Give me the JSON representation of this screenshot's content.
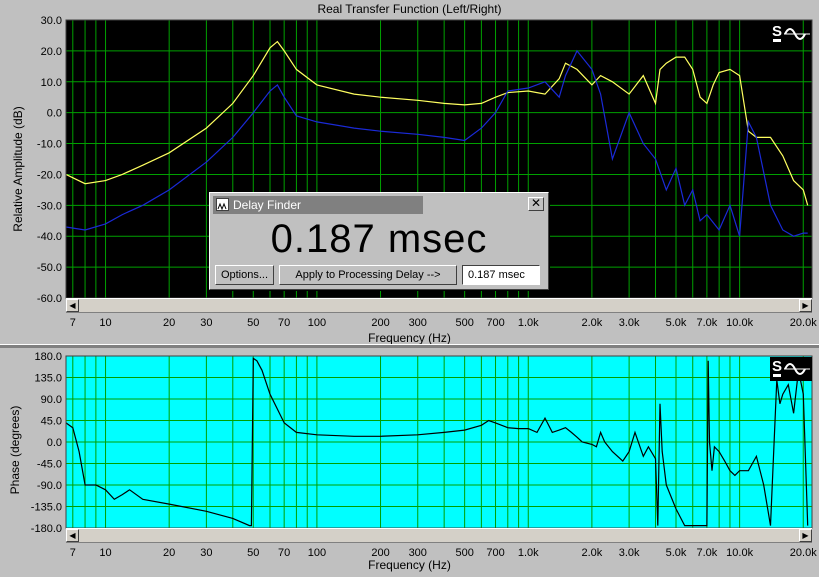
{
  "top_pane": {
    "title": "Real Transfer Function (Left/Right)",
    "ylabel": "Relative Amplitude (dB)",
    "xlabel": "Frequency (Hz)"
  },
  "bottom_pane": {
    "ylabel": "Phase (degrees)",
    "xlabel": "Frequency (Hz)"
  },
  "dialog": {
    "title": "Delay Finder",
    "value": "0.187 msec",
    "options_label": "Options...",
    "apply_label": "Apply to Processing Delay -->",
    "field_value": "0.187 msec",
    "close_glyph": "✕"
  },
  "colors": {
    "top_bg": "#000000",
    "bottom_bg": "#00ffff",
    "grid": "#00a000",
    "bottom_grid": "#00a000",
    "left_trace": "#ffff60",
    "right_trace": "#1a2ad8",
    "phase_trace": "#000000"
  },
  "chart_data": [
    {
      "type": "line",
      "title": "Real Transfer Function (Left/Right)",
      "xlabel": "Frequency (Hz)",
      "ylabel": "Relative Amplitude (dB)",
      "x_scale": "log",
      "xlim": [
        6.5,
        22000
      ],
      "ylim": [
        -60,
        30
      ],
      "yticks": [
        "30.0",
        "20.0",
        "10.0",
        "0.0",
        "-10.0",
        "-20.0",
        "-30.0",
        "-40.0",
        "-50.0",
        "-60.0"
      ],
      "xticks": [
        {
          "v": 7,
          "label": "7"
        },
        {
          "v": 10,
          "label": "10"
        },
        {
          "v": 20,
          "label": "20"
        },
        {
          "v": 30,
          "label": "30"
        },
        {
          "v": 50,
          "label": "50"
        },
        {
          "v": 70,
          "label": "70"
        },
        {
          "v": 100,
          "label": "100"
        },
        {
          "v": 200,
          "label": "200"
        },
        {
          "v": 300,
          "label": "300"
        },
        {
          "v": 500,
          "label": "500"
        },
        {
          "v": 700,
          "label": "700"
        },
        {
          "v": 1000,
          "label": "1.0k"
        },
        {
          "v": 2000,
          "label": "2.0k"
        },
        {
          "v": 3000,
          "label": "3.0k"
        },
        {
          "v": 5000,
          "label": "5.0k"
        },
        {
          "v": 7000,
          "label": "7.0k"
        },
        {
          "v": 10000,
          "label": "10.0k"
        },
        {
          "v": 20000,
          "label": "20.0k"
        }
      ],
      "grid": true,
      "series": [
        {
          "color": "#ffff60",
          "x": [
            6.5,
            8,
            10,
            12,
            15,
            20,
            30,
            40,
            50,
            60,
            65,
            70,
            80,
            100,
            150,
            200,
            300,
            400,
            500,
            600,
            700,
            800,
            1000,
            1200,
            1400,
            1500,
            1700,
            2000,
            2200,
            2500,
            3000,
            3500,
            4000,
            4200,
            4500,
            5000,
            5500,
            6000,
            6500,
            7000,
            7500,
            8000,
            9000,
            10000,
            11000,
            12000,
            14000,
            16000,
            18000,
            20000,
            21000
          ],
          "y": [
            -20,
            -23,
            -22,
            -20,
            -17,
            -13,
            -5,
            3,
            12,
            21,
            23,
            20,
            14,
            9,
            6,
            5,
            4,
            3,
            2.5,
            3,
            5,
            6.5,
            7,
            6,
            11,
            16,
            14,
            9,
            12,
            10,
            6,
            12,
            3,
            14,
            16,
            18,
            18,
            14,
            5,
            3,
            9,
            13,
            14,
            12,
            -6,
            -8,
            -8,
            -14,
            -22,
            -25,
            -30
          ]
        },
        {
          "color": "#1a2ad8",
          "x": [
            6.5,
            8,
            10,
            12,
            15,
            20,
            30,
            40,
            50,
            60,
            65,
            70,
            80,
            100,
            150,
            200,
            300,
            400,
            500,
            600,
            700,
            800,
            1000,
            1200,
            1400,
            1500,
            1700,
            2000,
            2200,
            2500,
            3000,
            3500,
            4000,
            4500,
            5000,
            5500,
            6000,
            6500,
            7000,
            8000,
            9000,
            10000,
            11000,
            12000,
            14000,
            16000,
            18000,
            20000,
            21000
          ],
          "y": [
            -37,
            -38,
            -36,
            -33,
            -30,
            -25,
            -16,
            -8,
            0,
            7,
            9,
            5,
            -1,
            -3,
            -5,
            -6,
            -7,
            -8,
            -9,
            -5,
            0,
            7,
            8,
            10,
            5,
            12,
            20,
            14,
            6,
            -15,
            0,
            -10,
            -15,
            -25,
            -18,
            -30,
            -25,
            -35,
            -33,
            -38,
            -30,
            -40,
            -3,
            -8,
            -30,
            -38,
            -40,
            -39,
            -39
          ]
        }
      ]
    },
    {
      "type": "line",
      "ylabel": "Phase (degrees)",
      "xlabel": "Frequency (Hz)",
      "x_scale": "log",
      "xlim": [
        6.5,
        22000
      ],
      "ylim": [
        -180,
        180
      ],
      "yticks": [
        "180.0",
        "135.0",
        "90.0",
        "45.0",
        "0.0",
        "-45.0",
        "-90.0",
        "-135.0",
        "-180.0"
      ],
      "xticks": [
        {
          "v": 7,
          "label": "7"
        },
        {
          "v": 10,
          "label": "10"
        },
        {
          "v": 20,
          "label": "20"
        },
        {
          "v": 30,
          "label": "30"
        },
        {
          "v": 50,
          "label": "50"
        },
        {
          "v": 70,
          "label": "70"
        },
        {
          "v": 100,
          "label": "100"
        },
        {
          "v": 200,
          "label": "200"
        },
        {
          "v": 300,
          "label": "300"
        },
        {
          "v": 500,
          "label": "500"
        },
        {
          "v": 700,
          "label": "700"
        },
        {
          "v": 1000,
          "label": "1.0k"
        },
        {
          "v": 2000,
          "label": "2.0k"
        },
        {
          "v": 3000,
          "label": "3.0k"
        },
        {
          "v": 5000,
          "label": "5.0k"
        },
        {
          "v": 7000,
          "label": "7.0k"
        },
        {
          "v": 10000,
          "label": "10.0k"
        },
        {
          "v": 20000,
          "label": "20.0k"
        }
      ],
      "grid": true,
      "series": [
        {
          "color": "#000000",
          "x": [
            6.5,
            7,
            7.5,
            8,
            9,
            10,
            11,
            12,
            13,
            15,
            20,
            30,
            40,
            48,
            49,
            50,
            52,
            55,
            60,
            70,
            80,
            100,
            150,
            200,
            300,
            400,
            500,
            600,
            650,
            700,
            800,
            900,
            1000,
            1100,
            1200,
            1300,
            1400,
            1500,
            1600,
            1700,
            1800,
            2000,
            2100,
            2200,
            2300,
            2500,
            2800,
            3000,
            3200,
            3500,
            3700,
            4000,
            4100,
            4200,
            4300,
            4500,
            5000,
            5500,
            6000,
            6500,
            7000,
            7100,
            7200,
            7400,
            7600,
            8000,
            8500,
            9000,
            9500,
            10000,
            11000,
            12000,
            13000,
            14000,
            15000,
            15500,
            16000,
            17000,
            18000,
            19000,
            20000,
            21000
          ],
          "y": [
            40,
            30,
            -20,
            -90,
            -90,
            -100,
            -120,
            -110,
            -100,
            -120,
            -130,
            -145,
            -160,
            -175,
            -175,
            175,
            170,
            150,
            100,
            40,
            20,
            15,
            12,
            12,
            15,
            20,
            25,
            35,
            45,
            40,
            30,
            28,
            28,
            20,
            50,
            20,
            25,
            30,
            20,
            10,
            0,
            -5,
            -10,
            20,
            0,
            -20,
            -40,
            -20,
            20,
            -30,
            -10,
            -35,
            -175,
            80,
            -20,
            -90,
            -140,
            -175,
            -175,
            -175,
            -175,
            170,
            0,
            -60,
            -10,
            -20,
            -40,
            -60,
            -70,
            -60,
            -60,
            -30,
            -90,
            -175,
            130,
            80,
            100,
            120,
            60,
            150,
            100,
            -175
          ]
        }
      ]
    }
  ]
}
